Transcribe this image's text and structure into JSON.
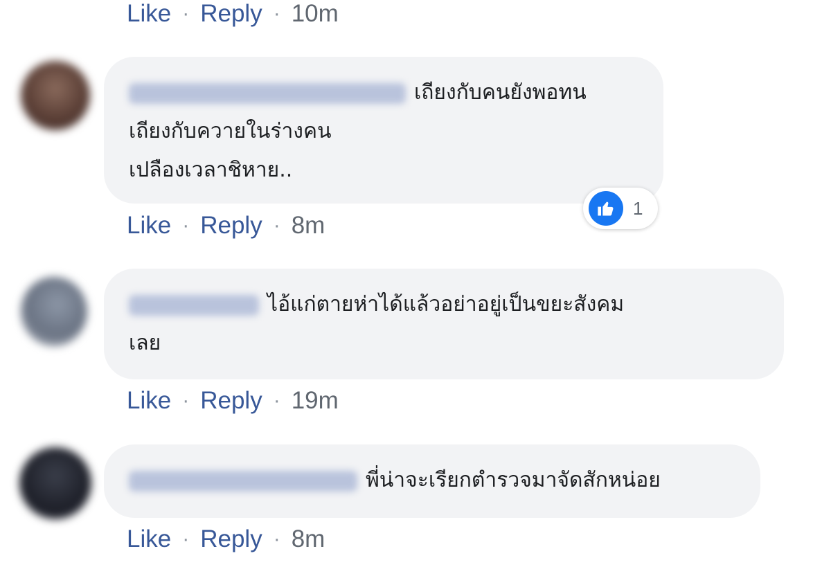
{
  "comments": [
    {
      "author": "",
      "text_lines": [],
      "like_label": "Like",
      "reply_label": "Reply",
      "time": "10m"
    },
    {
      "author": "",
      "text_lines": [
        "เถียงกับคนยังพอทน",
        "เถียงกับควายในร่างคน",
        "เปลืองเวลาชิหาย.."
      ],
      "reaction_count": "1",
      "like_label": "Like",
      "reply_label": "Reply",
      "time": "8m"
    },
    {
      "author": "",
      "text_lines": [
        "ไอ้แก่ตายห่าได้แล้วอย่าอยู่เป็นขยะสังคม",
        "เลย"
      ],
      "like_label": "Like",
      "reply_label": "Reply",
      "time": "19m"
    },
    {
      "author": "",
      "text_lines": [
        "พี่น่าจะเรียกตำรวจมาจัดสักหน่อย"
      ],
      "like_label": "Like",
      "reply_label": "Reply",
      "time": "8m"
    }
  ],
  "colors": {
    "link": "#385898",
    "bubble": "#f2f3f5",
    "like_blue": "#1877f2",
    "meta": "#606770"
  },
  "icons": {
    "reaction": "thumbs-up-icon"
  }
}
